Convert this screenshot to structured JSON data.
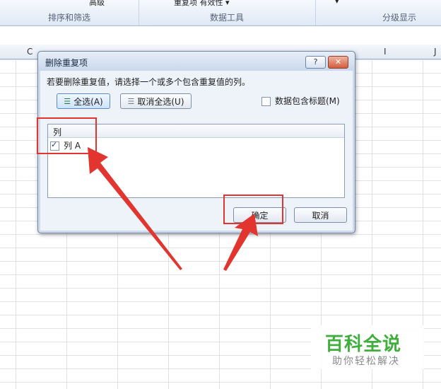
{
  "ribbon": {
    "groups": [
      {
        "label": "排序和筛选",
        "top_text": "高级"
      },
      {
        "label": "数据工具",
        "top_text": "重复项 有效性 ▾"
      },
      {
        "label": "分级显示",
        "top_text": "▾"
      }
    ]
  },
  "columns": [
    "C",
    "I",
    "J"
  ],
  "dialog": {
    "title": "删除重复项",
    "help_label": "?",
    "close_label": "✕",
    "instruction": "若要删除重复值，请选择一个或多个包含重复值的列。",
    "select_all_label": "全选(A)",
    "deselect_all_label": "取消全选(U)",
    "header_checkbox_label": "数据包含标题(M)",
    "header_checkbox_checked": false,
    "list_header": "列",
    "list_items": [
      {
        "label": "列 A",
        "checked": true
      }
    ],
    "ok_label": "确定",
    "cancel_label": "取消"
  },
  "watermark": {
    "title": "百科全说",
    "subtitle": "助你轻松解决"
  },
  "colors": {
    "annotation": "#e2352f",
    "watermark_green": "#3fae3c"
  }
}
